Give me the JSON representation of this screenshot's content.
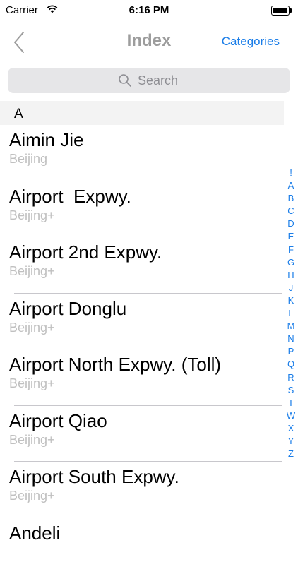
{
  "status_bar": {
    "carrier": "Carrier",
    "time": "6:16 PM"
  },
  "nav": {
    "title": "Index",
    "right_button": "Categories",
    "back_icon": "chevron-left-icon"
  },
  "search": {
    "placeholder": "Search",
    "icon": "search-icon"
  },
  "section": {
    "header": "A"
  },
  "rows": [
    {
      "name": "Aimin Jie",
      "sub": "Beijing"
    },
    {
      "name": "Airport  Expwy.",
      "sub": "Beijing+"
    },
    {
      "name": "Airport 2nd Expwy.",
      "sub": "Beijing+"
    },
    {
      "name": "Airport Donglu",
      "sub": "Beijing+"
    },
    {
      "name": "Airport North Expwy. (Toll)",
      "sub": "Beijing+"
    },
    {
      "name": "Airport Qiao",
      "sub": "Beijing+"
    },
    {
      "name": "Airport South Expwy.",
      "sub": "Beijing+"
    },
    {
      "name": "Andeli",
      "sub": ""
    }
  ],
  "index_letters": [
    "!",
    "A",
    "B",
    "C",
    "D",
    "E",
    "F",
    "G",
    "H",
    "J",
    "K",
    "L",
    "M",
    "N",
    "P",
    "Q",
    "R",
    "S",
    "T",
    "W",
    "X",
    "Y",
    "Z"
  ],
  "colors": {
    "accent": "#1a7de8",
    "title": "#9d9d9d",
    "subtitle": "#c0c0c0",
    "search_bg": "#e6e6e8",
    "section_bg": "#f3f3f3"
  }
}
